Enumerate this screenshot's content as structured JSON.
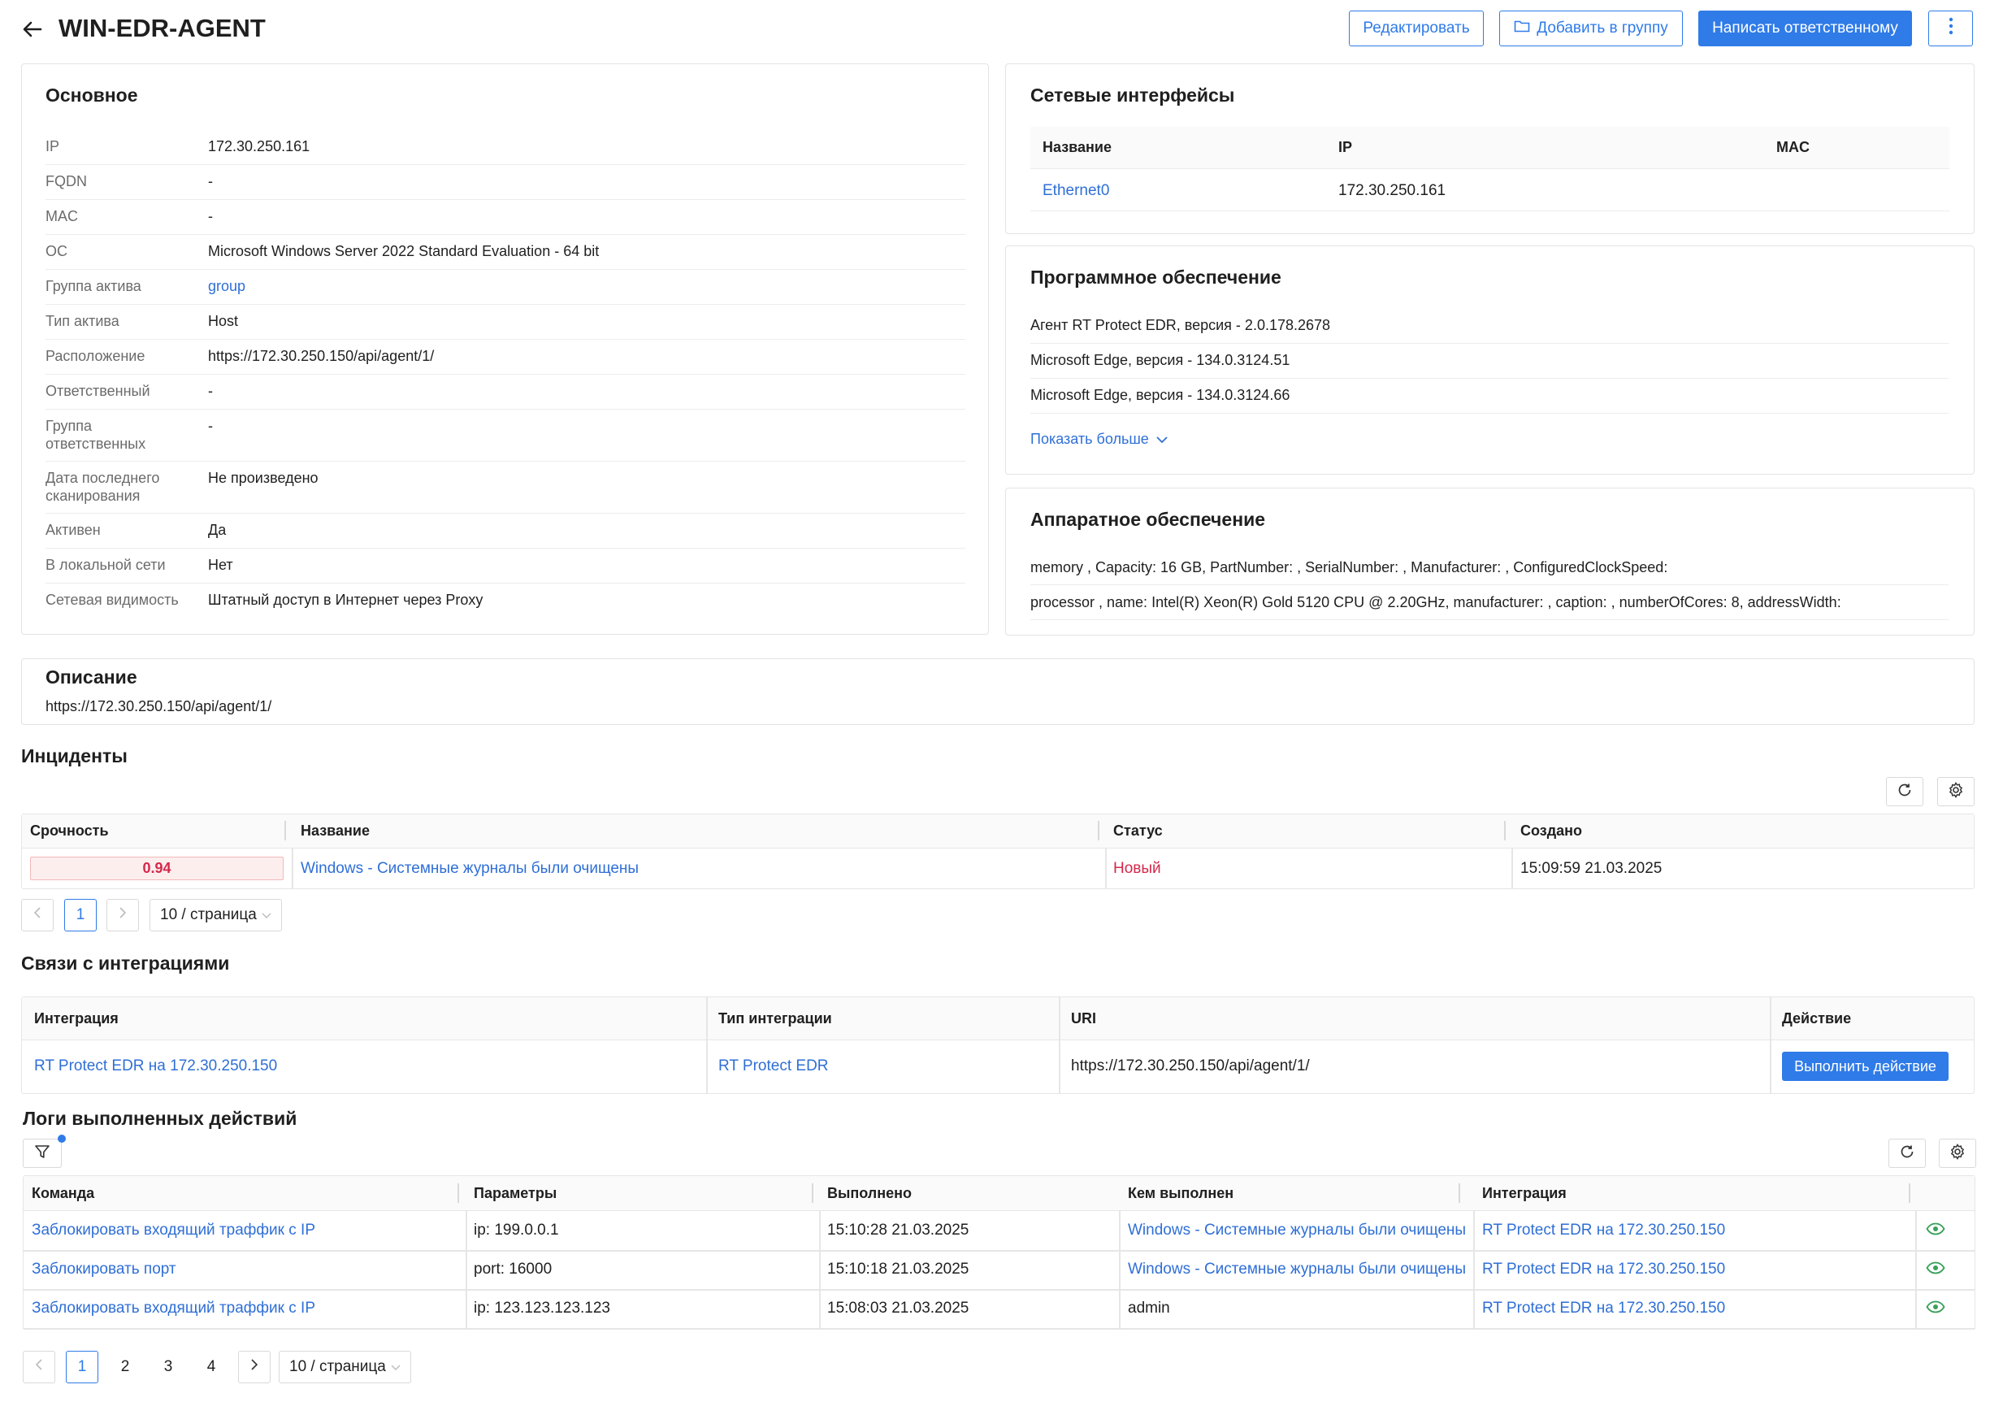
{
  "header": {
    "title": "WIN-EDR-AGENT",
    "edit_label": "Редактировать",
    "add_group_label": "Добавить в группу",
    "write_label": "Написать ответственному"
  },
  "main_info": {
    "title": "Основное",
    "rows": [
      {
        "label": "IP",
        "value": "172.30.250.161"
      },
      {
        "label": "FQDN",
        "value": "-"
      },
      {
        "label": "MAC",
        "value": "-"
      },
      {
        "label": "ОС",
        "value": "Microsoft Windows Server 2022 Standard Evaluation - 64 bit"
      },
      {
        "label": "Группа актива",
        "value": "group"
      },
      {
        "label": "Тип актива",
        "value": "Host"
      },
      {
        "label": "Расположение",
        "value": "https://172.30.250.150/api/agent/1/"
      },
      {
        "label": "Ответственный",
        "value": "-"
      },
      {
        "label": "Группа ответственных",
        "value": "-"
      },
      {
        "label": "Дата последнего сканирования",
        "value": "Не произведено"
      },
      {
        "label": "Активен",
        "value": "Да"
      },
      {
        "label": "В локальной сети",
        "value": "Нет"
      },
      {
        "label": "Сетевая видимость",
        "value": "Штатный доступ в Интернет через Proxy"
      }
    ]
  },
  "network": {
    "title": "Сетевые интерфейсы",
    "columns": [
      "Название",
      "IP",
      "MAC"
    ],
    "rows": [
      {
        "name": "Ethernet0",
        "ip": "172.30.250.161",
        "mac": ""
      }
    ]
  },
  "software": {
    "title": "Программное обеспечение",
    "items": [
      "Агент RT Protect EDR, версия - 2.0.178.2678",
      "Microsoft Edge, версия - 134.0.3124.51",
      "Microsoft Edge, версия - 134.0.3124.66"
    ],
    "show_more": "Показать больше"
  },
  "hardware": {
    "title": "Аппаратное обеспечение",
    "items": [
      "memory , Capacity: 16 GB, PartNumber: , SerialNumber: , Manufacturer: , ConfiguredClockSpeed:",
      "processor , name: Intel(R) Xeon(R) Gold 5120 CPU @ 2.20GHz, manufacturer: , caption: , numberOfCores: 8, addressWidth:"
    ]
  },
  "description": {
    "title": "Описание",
    "text": "https://172.30.250.150/api/agent/1/"
  },
  "incidents": {
    "title": "Инциденты",
    "columns": [
      "Срочность",
      "Название",
      "Статус",
      "Создано"
    ],
    "rows": [
      {
        "urgency": "0.94",
        "name": "Windows - Системные журналы были очищены",
        "status": "Новый",
        "created": "15:09:59 21.03.2025"
      }
    ],
    "page": "1",
    "page_size": "10 / страница"
  },
  "integrations": {
    "title": "Связи с интеграциями",
    "columns": [
      "Интеграция",
      "Тип интеграции",
      "URI",
      "Действие"
    ],
    "rows": [
      {
        "integration": "RT Protect EDR на 172.30.250.150",
        "type": "RT Protect EDR",
        "uri": "https://172.30.250.150/api/agent/1/",
        "action": "Выполнить действие"
      }
    ]
  },
  "logs": {
    "title": "Логи выполненных действий",
    "columns": [
      "Команда",
      "Параметры",
      "Выполнено",
      "Кем выполнен",
      "Интеграция"
    ],
    "rows": [
      {
        "command": "Заблокировать входящий траффик с IP",
        "params": "ip: 199.0.0.1",
        "done": "15:10:28 21.03.2025",
        "by": "Windows - Системные журналы были очищены",
        "by_link": true,
        "integration": "RT Protect EDR на 172.30.250.150"
      },
      {
        "command": "Заблокировать порт",
        "params": "port: 16000",
        "done": "15:10:18 21.03.2025",
        "by": "Windows - Системные журналы были очищены",
        "by_link": true,
        "integration": "RT Protect EDR на 172.30.250.150"
      },
      {
        "command": "Заблокировать входящий траффик с IP",
        "params": "ip: 123.123.123.123",
        "done": "15:08:03 21.03.2025",
        "by": "admin",
        "by_link": false,
        "integration": "RT Protect EDR на 172.30.250.150"
      }
    ],
    "pages": [
      "1",
      "2",
      "3",
      "4"
    ],
    "page_size": "10 / страница"
  },
  "colors": {
    "accent": "#2f7be8",
    "link": "#2f6fd6",
    "danger": "#d4294b",
    "eye": "#3aa05a"
  }
}
